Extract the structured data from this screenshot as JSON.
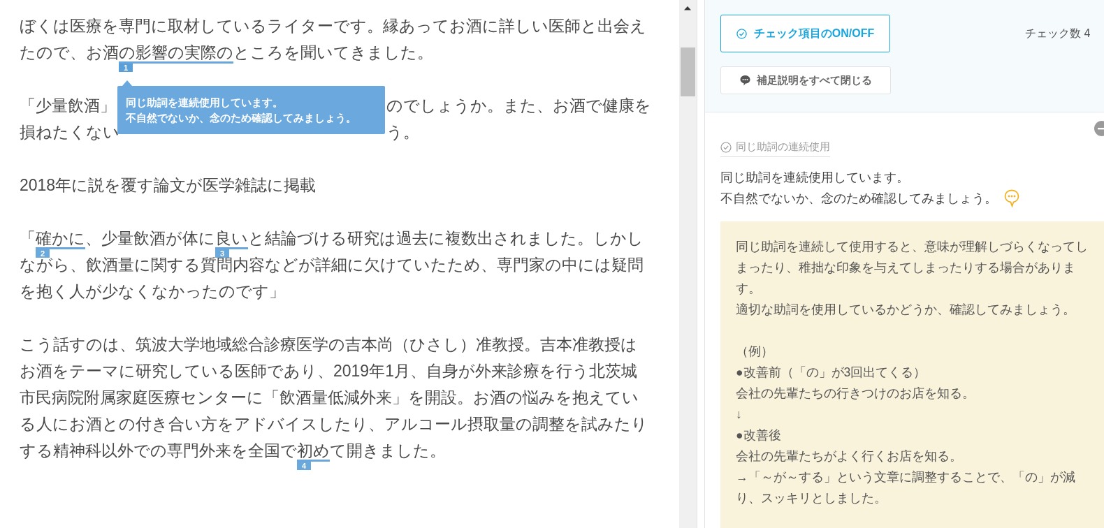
{
  "article": {
    "paragraphs": [
      {
        "segments": [
          {
            "text": "ぼくは医療を専門に取材しているライターです。縁あってお酒に詳しい医師と出会えたので、お酒"
          },
          {
            "text": "の影響の実際の",
            "marker": "1",
            "selected": true
          },
          {
            "text": "ところを聞いてきました。"
          }
        ]
      },
      {
        "kind": "covered",
        "lines": [
          [
            "「少量飲酒」",
            "のでしょうか。また、お酒で健康を"
          ],
          [
            "損ねたくない",
            "う。"
          ]
        ]
      },
      {
        "segments": [
          {
            "text": "2018年に説を覆す論文が医学雑誌に掲載"
          }
        ]
      },
      {
        "segments": [
          {
            "text": "「"
          },
          {
            "text": "確かに",
            "marker": "2",
            "selected": false
          },
          {
            "text": "、少量飲酒が体に"
          },
          {
            "text": "良い",
            "marker": "3",
            "selected": false
          },
          {
            "text": "と結論づける研究は過去に複数出されました。しかしながら、飲酒量に関する質問内容などが詳細に欠けていたため、専門家の中には疑問を抱く人が少なくなかったのです」"
          }
        ]
      },
      {
        "segments": [
          {
            "text": "こう話すのは、筑波大学地域総合診療医学の吉本尚（ひさし）准教授。吉本准教授はお酒をテーマに研究している医師であり、2019年1月、自身が外来診療を行う北茨城市民病院附属家庭医療センターに「飲酒量低減外来」を開設。お酒の悩みを抱えている人にお酒との付き合い方をアドバイスしたり、アルコール摂取量の調整を試みたりする精神科以外での専門外来を全国で"
          },
          {
            "text": "初め",
            "marker": "4",
            "selected": false
          },
          {
            "text": "て開きました。"
          }
        ]
      }
    ]
  },
  "tooltip": {
    "lines": [
      "同じ助詞を連続使用しています。",
      "不自然でないか、念のため確認してみましょう。"
    ]
  },
  "toolbar": {
    "toggle_button": "チェック項目のON/OFF",
    "check_count": "チェック数 4",
    "close_notes_button": "補足説明をすべて閉じる"
  },
  "detail": {
    "category": "同じ助詞の連続使用",
    "message": [
      "同じ助詞を連続使用しています。",
      "不自然でないか、念のため確認してみましょう。"
    ],
    "note": {
      "expanded": true,
      "groups": [
        [
          "同じ助詞を連続して使用すると、意味が理解しづらくなってしまったり、稚拙な印象を与えてしまったりする場合があります。",
          "適切な助詞を使用しているかどうか、確認してみましょう。"
        ],
        [
          "（例）",
          "●改善前（「の」が3回出てくる）",
          "会社の先輩たちの行きつけのお店を知る。",
          "↓",
          "●改善後",
          "会社の先輩たちがよく行くお店を知る。",
          "→「～が～する」という文章に調整することで、「の」が減り、スッキリとしました。"
        ]
      ]
    }
  }
}
